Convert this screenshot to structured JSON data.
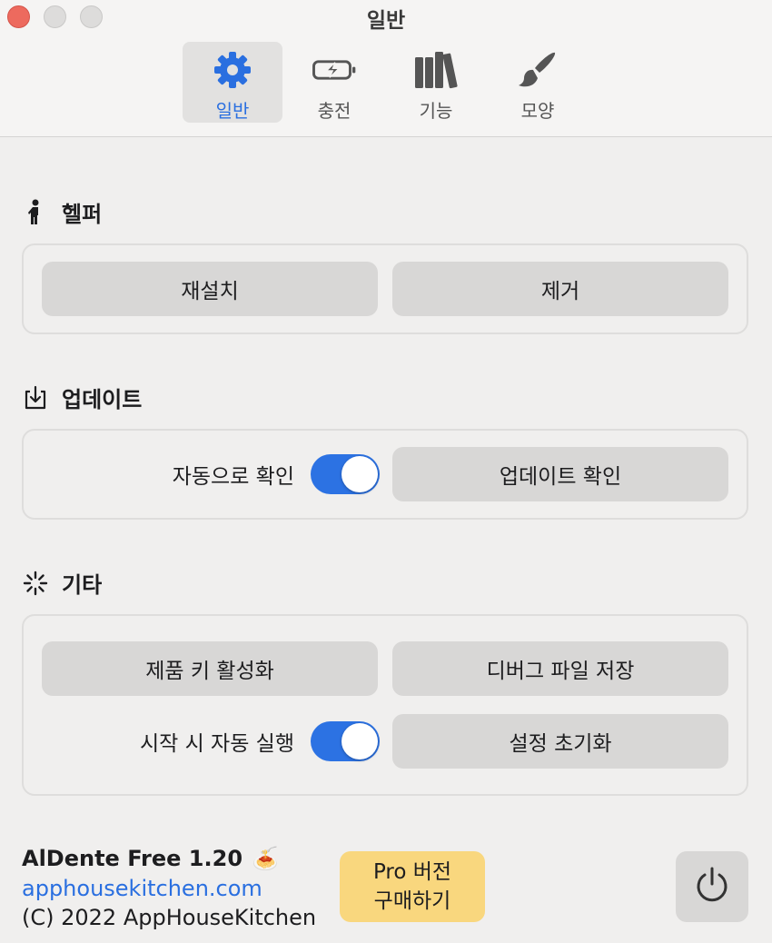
{
  "window": {
    "title": "일반"
  },
  "tabs": [
    {
      "label": "일반",
      "icon": "gear-icon",
      "active": true
    },
    {
      "label": "충전",
      "icon": "battery-charging-icon",
      "active": false
    },
    {
      "label": "기능",
      "icon": "books-icon",
      "active": false
    },
    {
      "label": "모양",
      "icon": "paintbrush-icon",
      "active": false
    }
  ],
  "helper": {
    "title": "헬퍼",
    "icon": "person-walking-icon",
    "reinstall_label": "재설치",
    "remove_label": "제거"
  },
  "update": {
    "title": "업데이트",
    "icon": "download-tray-icon",
    "auto_check_label": "자동으로 확인",
    "auto_check_on": true,
    "check_label": "업데이트 확인"
  },
  "other": {
    "title": "기타",
    "icon": "spinner-icon",
    "activate_key_label": "제품 키 활성화",
    "save_debug_label": "디버그 파일 저장",
    "launch_at_login_label": "시작 시 자동 실행",
    "launch_at_login_on": true,
    "reset_label": "설정 초기화"
  },
  "footer": {
    "app_name": "AlDente Free 1.20",
    "app_emoji": "🍝",
    "link": "apphousekitchen.com",
    "copyright": "(C) 2022 AppHouseKitchen",
    "pro_line1": "Pro 버전",
    "pro_line2": "구매하기",
    "power_icon": "power-icon"
  },
  "colors": {
    "accent": "#2c72e3",
    "pro_button": "#f9d77e",
    "close": "#ed6a5e"
  }
}
